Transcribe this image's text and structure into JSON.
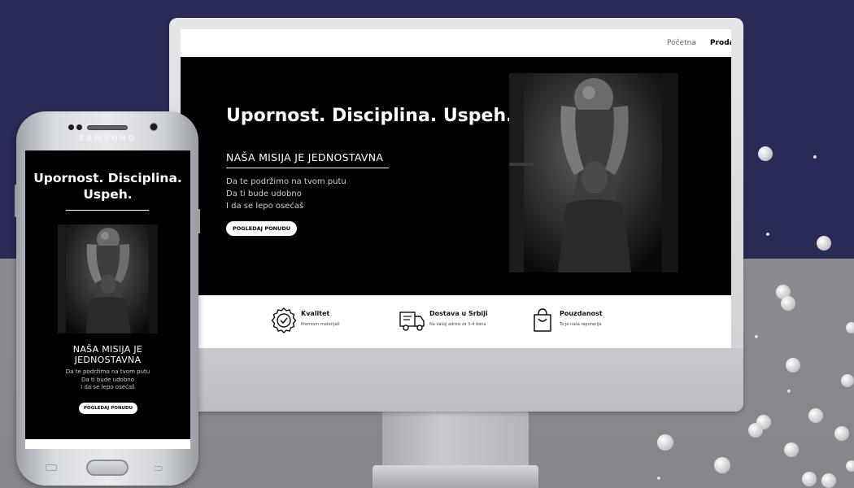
{
  "desktop": {
    "nav": {
      "home_label": "Početna",
      "shop_label": "Proda"
    },
    "hero": {
      "title": "Upornost. Disciplina. Uspeh.",
      "subtitle": "NAŠA MISIJA JE JEDNOSTAVNA",
      "lines": [
        "Da te podržimo na tvom putu",
        "Da ti bude udobno",
        "I da se lepo osećaš"
      ],
      "cta_label": "POGLEDAJ PONUDU"
    },
    "features": [
      {
        "icon": "badge-check-icon",
        "title": "Kvalitet",
        "desc": "Premium materijali"
      },
      {
        "icon": "truck-icon",
        "title": "Dostava u Srbiji",
        "desc": "Na vašoj adresi za 3-4 dana"
      },
      {
        "icon": "shopping-bag-icon",
        "title": "Pouzdanost",
        "desc": "To je naša reputacija"
      }
    ]
  },
  "mobile": {
    "brand": "SAMSUNG",
    "hero": {
      "title_line1": "Upornost. Disciplina.",
      "title_line2": "Uspeh.",
      "subtitle_line1": "NAŠA MISIJA JE",
      "subtitle_line2": "JEDNOSTAVNA",
      "lines": [
        "Da te podržimo na tvom putu",
        "Da ti bude udobno",
        "I da se lepo osećaš"
      ],
      "cta_label": "POGLEDAJ PONUDU"
    }
  },
  "colors": {
    "background_top": "#2a2a57",
    "background_bottom": "#8c8c90",
    "hero_bg": "#000000",
    "button_bg": "#ffffff"
  }
}
